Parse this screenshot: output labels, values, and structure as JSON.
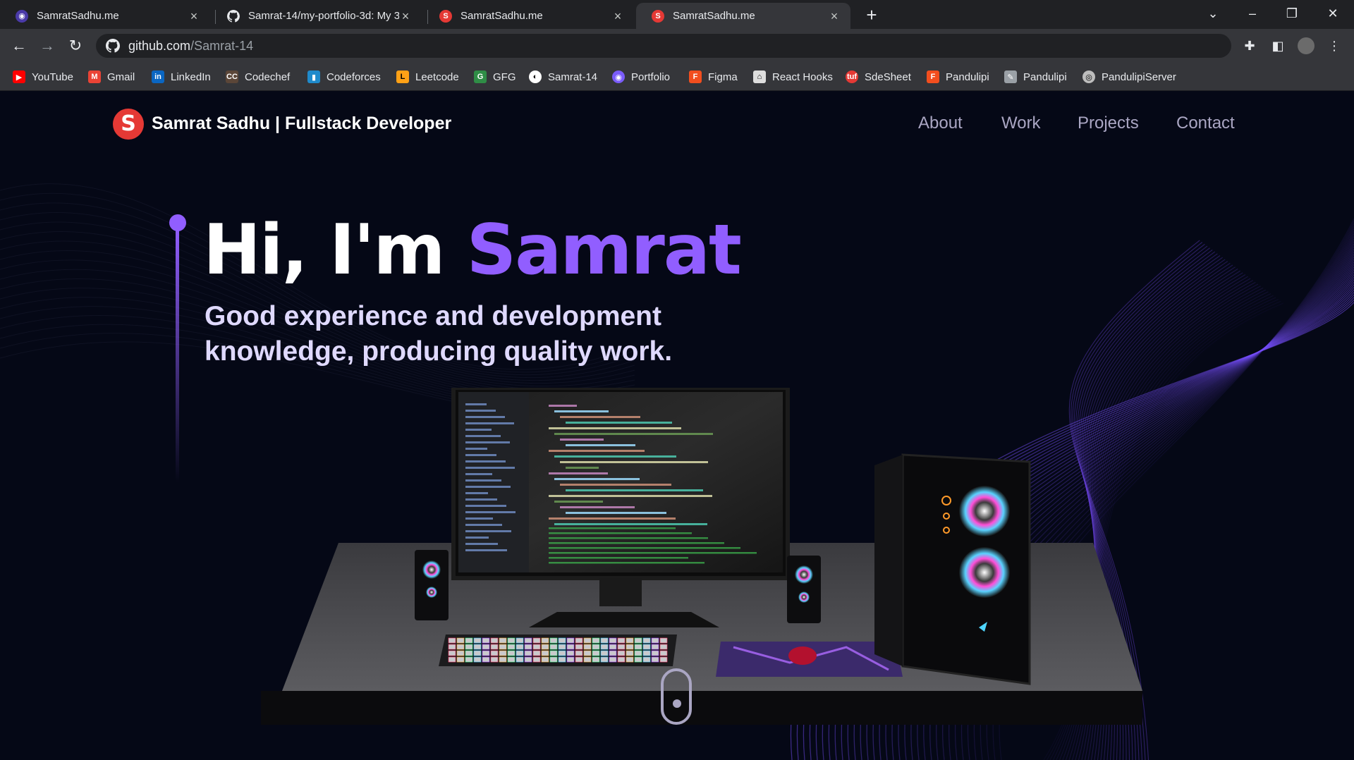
{
  "browser": {
    "tabs": [
      {
        "title": "SamratSadhu.me",
        "icon": "globe-purple-icon"
      },
      {
        "title": "Samrat-14/my-portfolio-3d: My 3",
        "icon": "github-icon"
      },
      {
        "title": "SamratSadhu.me",
        "icon": "logo-s-icon"
      },
      {
        "title": "SamratSadhu.me",
        "icon": "logo-s-icon",
        "active": true
      }
    ],
    "url_host": "github.com",
    "url_path": "/Samrat-14",
    "bookmarks": [
      {
        "label": "YouTube",
        "color": "#ff0000"
      },
      {
        "label": "Gmail",
        "color": "#ea4335"
      },
      {
        "label": "LinkedIn",
        "color": "#0a66c2"
      },
      {
        "label": "Codechef",
        "color": "#5b4638"
      },
      {
        "label": "Codeforces",
        "color": "#1f8acb"
      },
      {
        "label": "Leetcode",
        "color": "#ffa116"
      },
      {
        "label": "GFG",
        "color": "#2f8d46"
      },
      {
        "label": "Samrat-14",
        "color": "#ffffff"
      },
      {
        "label": "Portfolio",
        "color": "#7a5cfa"
      },
      {
        "label": "Figma",
        "color": "#f24e1e"
      },
      {
        "label": "React Hooks",
        "color": "#dddddd"
      },
      {
        "label": "SdeSheet",
        "color": "#e53935"
      },
      {
        "label": "Pandulipi",
        "color": "#f24e1e"
      },
      {
        "label": "Pandulipi",
        "color": "#9aa0a6"
      },
      {
        "label": "PandulipiServer",
        "color": "#bdbdbd"
      }
    ]
  },
  "site": {
    "logo_letter": "S",
    "brand": "Samrat Sadhu | Fullstack Developer",
    "nav": [
      "About",
      "Work",
      "Projects",
      "Contact"
    ],
    "hero_greeting": "Hi, I'm ",
    "hero_name": "Samrat",
    "hero_sub_line1": "Good experience and development",
    "hero_sub_line2": "knowledge, producing quality work.",
    "accent_color": "#915eff",
    "background_color": "#050816"
  }
}
